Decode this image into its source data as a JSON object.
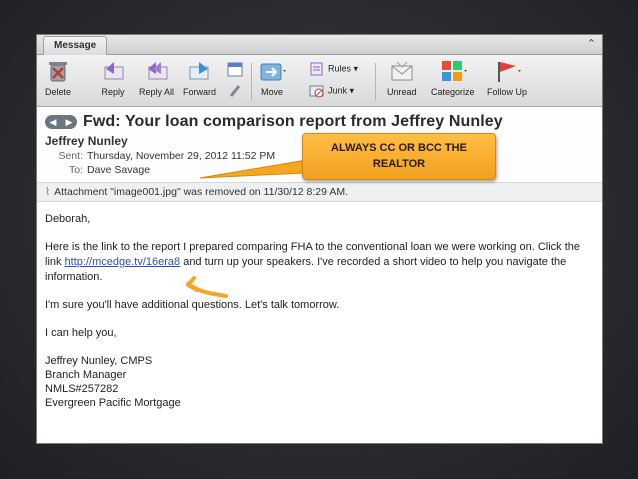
{
  "window": {
    "tab_label": "Message",
    "collapse_glyph": "⌃"
  },
  "toolbar": {
    "delete": "Delete",
    "reply": "Reply",
    "reply_all": "Reply All",
    "forward": "Forward",
    "move": "Move",
    "rules": "Rules",
    "junk": "Junk",
    "unread": "Unread",
    "categorize": "Categorize",
    "follow_up": "Follow Up"
  },
  "message": {
    "subject": "Fwd: Your loan comparison report from Jeffrey Nunley",
    "from": "Jeffrey Nunley",
    "sent_label": "Sent:",
    "sent_value": "Thursday, November 29, 2012 11:52 PM",
    "to_label": "To:",
    "to_value": "Dave Savage",
    "attachment_note": "Attachment \"image001.jpg\" was removed on 11/30/12 8:29 AM."
  },
  "body": {
    "greeting": "Deborah,",
    "p1_before": "Here is the link to the report I prepared comparing FHA to the conventional loan we were working on.  Click the link ",
    "link": "http://mcedge.tv/16era8",
    "p1_after": " and turn up your speakers.  I've recorded a short video to help you navigate the information.",
    "p2": "I'm sure you'll have additional questions.  Let's talk tomorrow.",
    "p3": "I can help you,",
    "sig": [
      "Jeffrey Nunley, CMPS",
      "Branch Manager",
      "NMLS#257282",
      "Evergreen Pacific Mortgage"
    ]
  },
  "annotation": {
    "callout_line1": "ALWAYS CC OR BCC THE",
    "callout_line2": "REALTOR",
    "color": "#f5a623"
  }
}
